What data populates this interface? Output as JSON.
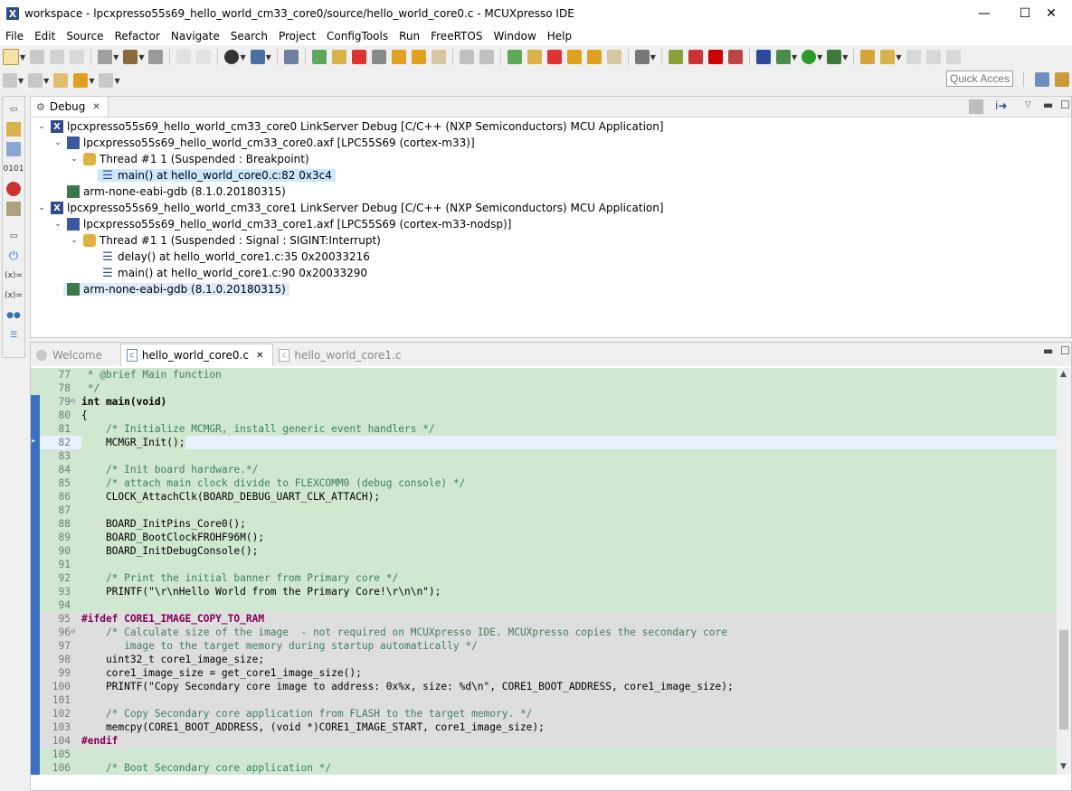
{
  "window": {
    "title": "workspace - lpcxpresso55s69_hello_world_cm33_core0/source/hello_world_core0.c - MCUXpresso IDE",
    "minimize": "—",
    "maximize": "☐",
    "close": "✕"
  },
  "menu": [
    "File",
    "Edit",
    "Source",
    "Refactor",
    "Navigate",
    "Search",
    "Project",
    "ConfigTools",
    "Run",
    "FreeRTOS",
    "Window",
    "Help"
  ],
  "quick_access": "Quick Access",
  "debug_view": {
    "tab_label": "Debug",
    "tree": [
      {
        "label": "lpcxpresso55s69_hello_world_cm33_core0 LinkServer Debug [C/C++ (NXP Semiconductors) MCU Application]",
        "icon": "launch-icon"
      },
      {
        "label": "lpcxpresso55s69_hello_world_cm33_core0.axf [LPC55S69 (cortex-m33)]",
        "icon": "process-icon"
      },
      {
        "label": "Thread #1 1 (Suspended : Breakpoint)",
        "icon": "thread-icon"
      },
      {
        "label": "main() at hello_world_core0.c:82 0x3c4",
        "icon": "stack-frame-icon"
      },
      {
        "label": "arm-none-eabi-gdb (8.1.0.20180315)",
        "icon": "gdb-icon"
      },
      {
        "label": "lpcxpresso55s69_hello_world_cm33_core1 LinkServer Debug [C/C++ (NXP Semiconductors) MCU Application]",
        "icon": "launch-icon"
      },
      {
        "label": "lpcxpresso55s69_hello_world_cm33_core1.axf [LPC55S69 (cortex-m33-nodsp)]",
        "icon": "process-icon"
      },
      {
        "label": "Thread #1 1 (Suspended : Signal : SIGINT:Interrupt)",
        "icon": "thread-icon"
      },
      {
        "label": "delay() at hello_world_core1.c:35 0x20033216",
        "icon": "stack-frame-icon"
      },
      {
        "label": "main() at hello_world_core1.c:90 0x20033290",
        "icon": "stack-frame-icon"
      },
      {
        "label": "arm-none-eabi-gdb (8.1.0.20180315)",
        "icon": "gdb-icon"
      }
    ]
  },
  "editor": {
    "tabs": [
      {
        "label": "Welcome",
        "icon": "welcome-icon"
      },
      {
        "label": "hello_world_core0.c",
        "icon": "c-file-icon",
        "close": "✕"
      },
      {
        "label": "hello_world_core1.c",
        "icon": "c-file-icon"
      }
    ],
    "lines": [
      {
        "n": "77",
        "text": " * @brief Main function"
      },
      {
        "n": "78",
        "text": " */"
      },
      {
        "n": "79",
        "text": "int main(void)"
      },
      {
        "n": "80",
        "text": "{"
      },
      {
        "n": "81",
        "text": "    /* Initialize MCMGR, install generic event handlers */"
      },
      {
        "n": "82",
        "text": "    MCMGR_Init();"
      },
      {
        "n": "83",
        "text": ""
      },
      {
        "n": "84",
        "text": "    /* Init board hardware.*/"
      },
      {
        "n": "85",
        "text": "    /* attach main clock divide to FLEXCOMM0 (debug console) */"
      },
      {
        "n": "86",
        "text": "    CLOCK_AttachClk(BOARD_DEBUG_UART_CLK_ATTACH);"
      },
      {
        "n": "87",
        "text": ""
      },
      {
        "n": "88",
        "text": "    BOARD_InitPins_Core0();"
      },
      {
        "n": "89",
        "text": "    BOARD_BootClockFROHF96M();"
      },
      {
        "n": "90",
        "text": "    BOARD_InitDebugConsole();"
      },
      {
        "n": "91",
        "text": ""
      },
      {
        "n": "92",
        "text": "    /* Print the initial banner from Primary core */"
      },
      {
        "n": "93",
        "text": "    PRINTF(\"\\r\\nHello World from the Primary Core!\\r\\n\\n\");"
      },
      {
        "n": "94",
        "text": ""
      },
      {
        "n": "95",
        "text": "#ifdef CORE1_IMAGE_COPY_TO_RAM"
      },
      {
        "n": "96",
        "text": "    /* Calculate size of the image  - not required on MCUXpresso IDE. MCUXpresso copies the secondary core"
      },
      {
        "n": "97",
        "text": "       image to the target memory during startup automatically */"
      },
      {
        "n": "98",
        "text": "    uint32_t core1_image_size;"
      },
      {
        "n": "99",
        "text": "    core1_image_size = get_core1_image_size();"
      },
      {
        "n": "100",
        "text": "    PRINTF(\"Copy Secondary core image to address: 0x%x, size: %d\\n\", CORE1_BOOT_ADDRESS, core1_image_size);"
      },
      {
        "n": "101",
        "text": ""
      },
      {
        "n": "102",
        "text": "    /* Copy Secondary core application from FLASH to the target memory. */"
      },
      {
        "n": "103",
        "text": "    memcpy(CORE1_BOOT_ADDRESS, (void *)CORE1_IMAGE_START, core1_image_size);"
      },
      {
        "n": "104",
        "text": "#endif"
      },
      {
        "n": "105",
        "text": ""
      },
      {
        "n": "106",
        "text": "    /* Boot Secondary core application */"
      }
    ]
  }
}
